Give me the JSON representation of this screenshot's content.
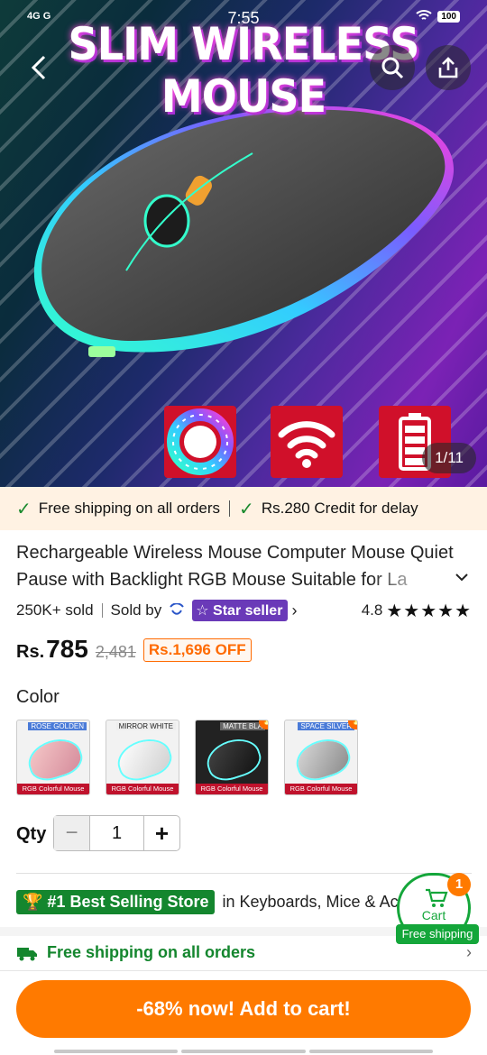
{
  "status_bar": {
    "time": "7:55",
    "network_left": "4G G",
    "battery": "100"
  },
  "hero": {
    "banner_text": "SLIM WIRELESS MOUSE",
    "image_counter": "1/11"
  },
  "shipping_banner": {
    "item1": "Free shipping on all orders",
    "item2": "Rs.280 Credit for delay"
  },
  "product": {
    "title": "Rechargeable Wireless Mouse Computer Mouse Quiet Pause with Backlight RGB Mouse Suitable for La",
    "sold": "250K+ sold",
    "sold_by": "Sold by",
    "seller_badge": "Star seller",
    "rating": "4.8",
    "stars": "★★★★★"
  },
  "price": {
    "currency": "Rs.",
    "value": "785",
    "original": "2,481",
    "discount": "Rs.1,696 OFF"
  },
  "color": {
    "label": "Color",
    "options": [
      {
        "name": "ROSE GOLDEN",
        "caption": "RGB Colorful Mouse",
        "hot": false
      },
      {
        "name": "MIRROR WHITE",
        "caption": "RGB Colorful Mouse",
        "hot": false
      },
      {
        "name": "MATTE BLA",
        "caption": "RGB Colorful Mouse",
        "hot": true
      },
      {
        "name": "SPACE SILVER",
        "caption": "RGB Colorful Mouse",
        "hot": true
      }
    ]
  },
  "quantity": {
    "label": "Qty",
    "value": "1",
    "minus": "−",
    "plus": "+"
  },
  "store": {
    "badge": "#1 Best Selling Store",
    "category": "in Keyboards, Mice & Acc"
  },
  "free_shipping_row": {
    "text": "Free shipping on all orders"
  },
  "cart": {
    "label": "Cart",
    "count": "1",
    "free_tag": "Free shipping"
  },
  "cta": {
    "label": "-68% now! Add to cart!"
  },
  "colors": {
    "accent": "#ff7a00",
    "green": "#14862e",
    "seller_purple": "#6a3ab8"
  }
}
